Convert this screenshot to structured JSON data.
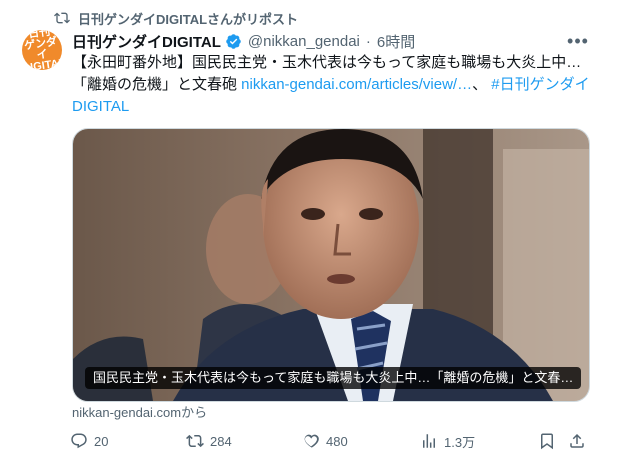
{
  "repost": {
    "text": "日刊ゲンダイDIGITALさんがリポスト",
    "icon": "repost-icon"
  },
  "author": {
    "avatar_text": "日刊\nゲンダイ\nDIGITAL",
    "avatar_color": "#f08a2b",
    "name": "日刊ゲンダイDIGITAL",
    "verified": true,
    "handle": "@nikkan_gendai",
    "separator": "·",
    "time": "6時間"
  },
  "tweet": {
    "line1": "【永田町番外地】国民民主党・玉木代表は今もって家庭も職場も大炎上中…",
    "line2_plain": "「離婚の危機」と文春砲 ",
    "link": "nikkan-gendai.com/articles/view/…",
    "separator": "、 ",
    "hashtag": "#日刊ゲンダイDIGITAL"
  },
  "card": {
    "caption": "国民民主党・玉木代表は今もって家庭も職場も大炎上中…「離婚の危機」と文春…",
    "source": "nikkan-gendai.comから"
  },
  "actions": {
    "replies": "20",
    "reposts": "284",
    "likes": "480",
    "views": "1.3万"
  },
  "colors": {
    "accent": "#1d9bf0",
    "muted": "#536471",
    "text": "#0f1419"
  }
}
